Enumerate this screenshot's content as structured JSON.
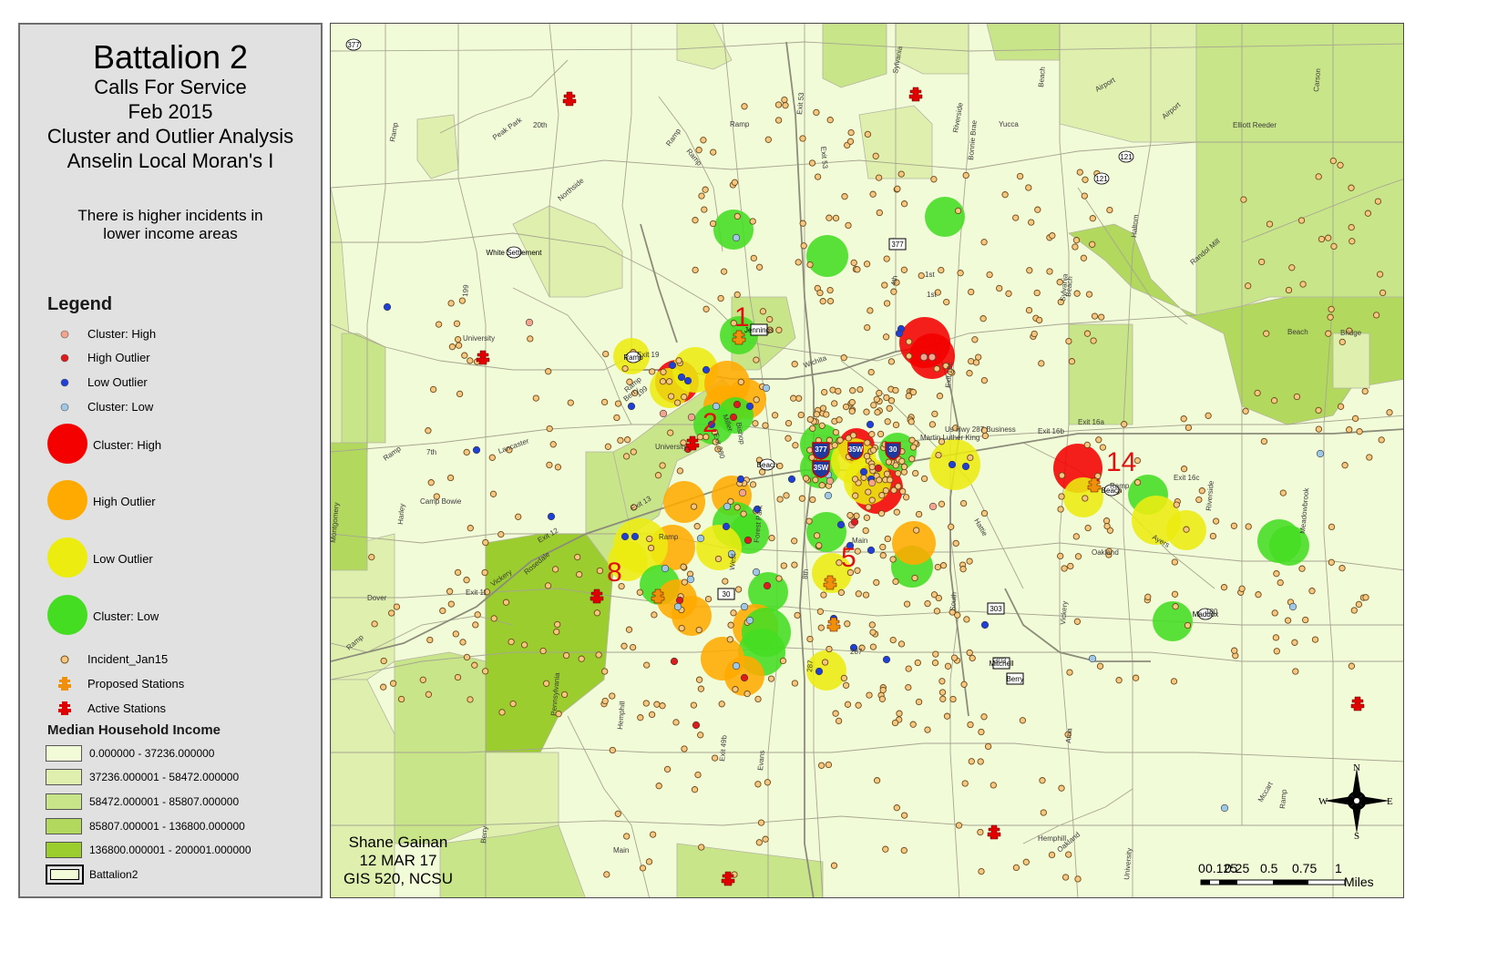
{
  "title": {
    "main": "Battalion 2",
    "line1": "Calls For Service",
    "line2": "Feb 2015",
    "line3": "Cluster and Outlier Analysis",
    "line4": "Anselin Local Moran's I"
  },
  "note": {
    "line1": "There is higher incidents in",
    "line2": "lower income areas"
  },
  "legend": {
    "heading": "Legend",
    "point_items": [
      {
        "label": "Cluster: High",
        "color": "#f4a48c"
      },
      {
        "label": "High Outlier",
        "color": "#e01b1b"
      },
      {
        "label": "Low Outlier",
        "color": "#1f3fd6"
      },
      {
        "label": "Cluster: Low",
        "color": "#9ec8e6"
      }
    ],
    "circle_items": [
      {
        "label": "Cluster: High",
        "color": "#f40000"
      },
      {
        "label": "High Outlier",
        "color": "#ffaa00"
      },
      {
        "label": "Low Outlier",
        "color": "#ecec10"
      },
      {
        "label": "Cluster: Low",
        "color": "#44dd22"
      }
    ],
    "incident_label": "Incident_Jan15",
    "proposed_label": "Proposed Stations",
    "active_label": "Active Stations",
    "income_heading": "Median Household Income",
    "income_classes": [
      {
        "label": "0.000000 - 37236.000000",
        "color": "#f2fbd8"
      },
      {
        "label": "37236.000001 - 58472.000000",
        "color": "#dff0ae"
      },
      {
        "label": "58472.000001 - 85807.000000",
        "color": "#c9e58a"
      },
      {
        "label": "85807.000001 - 136800.000000",
        "color": "#b2d95e"
      },
      {
        "label": "136800.000001 - 200001.000000",
        "color": "#9ccd2f"
      }
    ],
    "battalion_label": "Battalion2"
  },
  "credit": {
    "line1": "Shane Gainan",
    "line2": "12 MAR 17",
    "line3": "GIS 520, NCSU"
  },
  "station_numbers": [
    "1",
    "2",
    "5",
    "8",
    "14"
  ],
  "north_arrow": {
    "n": "N",
    "s": "S",
    "e": "E",
    "w": "W"
  },
  "scale_bar": {
    "ticks": [
      "0",
      "0.125",
      "0.25",
      "0.5",
      "0.75",
      "1"
    ],
    "unit": "Miles"
  },
  "road_labels": [
    "Ramp",
    "20th",
    "Peak Park",
    "Northside",
    "Ramp",
    "Ramp",
    "Ramp",
    "Exit 53",
    "Exit 53",
    "Sylvania",
    "Riverside",
    "Bonnie Brae",
    "Yucca",
    "Beach",
    "Airport",
    "Airport",
    "Elliott Reeder",
    "Carson",
    "Beach",
    "121",
    "121",
    "Haltom",
    "Randol Mill",
    "1st",
    "1st",
    "4th",
    "Sylvania",
    "Beach",
    "Bridge",
    "Exit 19",
    "199",
    "University",
    "White Settlement",
    "University",
    "199",
    "Ramp",
    "Ramp",
    "7th",
    "Lancaster",
    "Ramp",
    "Camp Bowie",
    "Harley",
    "Montgomery",
    "Dover",
    "Exit 11",
    "Ramp",
    "Vickery",
    "Rosedale",
    "Exit 12",
    "Exit 13",
    "Ramp",
    "West",
    "Pennsylvania",
    "Hemphill",
    "Forest Park",
    "8th",
    "Main",
    "South",
    "Hattie",
    "Us Hwy 287 Business",
    "Martin Luther King",
    "Exit 16b",
    "Exit 16a",
    "Exit 16c",
    "Exit 16c",
    "Riverside",
    "Meadowbrook",
    "Ayers",
    "Oakland",
    "Ramp",
    "Vickery",
    "180",
    "Beach",
    "303",
    "287",
    "Maddox",
    "287",
    "Exit 49b",
    "Evans",
    "Ama",
    "Hemphill",
    "Main",
    "Mitchell",
    "Berry",
    "Berry",
    "Oakland",
    "University",
    "Mccart",
    "Ramp",
    "Berry",
    "Wichita",
    "Bishop",
    "Miller",
    "Exit 280",
    "Spur 280",
    "13th",
    "Commerce",
    "Jennings",
    "377",
    "377",
    "35W",
    "35W",
    "30",
    "30",
    "303",
    "303"
  ]
}
